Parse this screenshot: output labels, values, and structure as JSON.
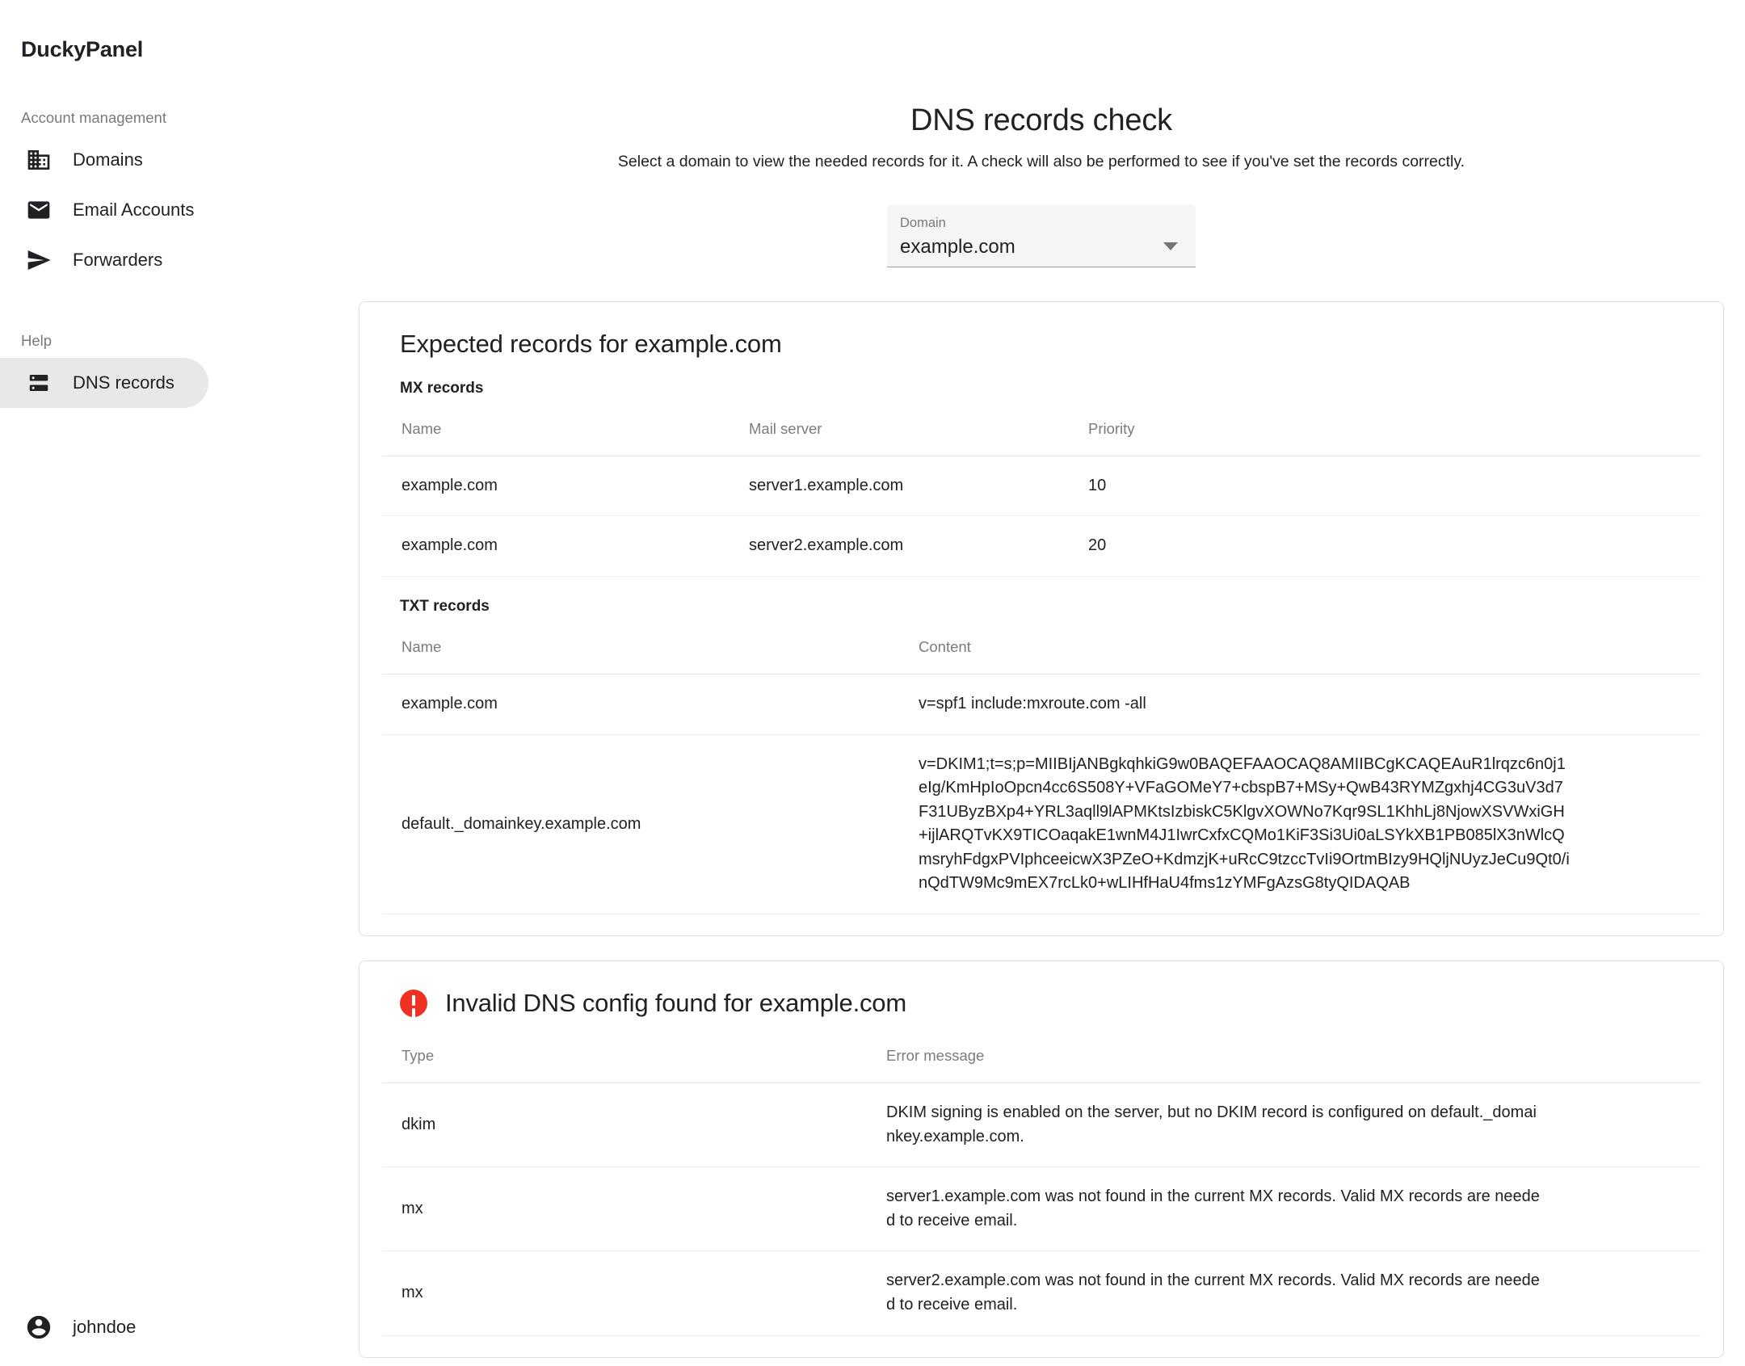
{
  "brand": "DuckyPanel",
  "sidebar": {
    "sections": [
      {
        "label": "Account management"
      },
      {
        "label": "Help"
      }
    ],
    "items": [
      {
        "label": "Domains",
        "icon": "domain-icon",
        "active": false
      },
      {
        "label": "Email Accounts",
        "icon": "email-icon",
        "active": false
      },
      {
        "label": "Forwarders",
        "icon": "send-icon",
        "active": false
      },
      {
        "label": "DNS records",
        "icon": "dns-icon",
        "active": true
      }
    ],
    "user": {
      "name": "johndoe",
      "icon": "account-circle-icon"
    }
  },
  "page": {
    "title": "DNS records check",
    "subtitle": "Select a domain to view the needed records for it. A check will also be performed to see if you've set the records correctly."
  },
  "domain_select": {
    "label": "Domain",
    "value": "example.com",
    "icon": "chevron-down-icon"
  },
  "expected_card": {
    "title": "Expected records for example.com",
    "mx": {
      "section_label": "MX records",
      "headers": [
        "Name",
        "Mail server",
        "Priority"
      ],
      "rows": [
        {
          "name": "example.com",
          "server": "server1.example.com",
          "priority": "10"
        },
        {
          "name": "example.com",
          "server": "server2.example.com",
          "priority": "20"
        }
      ]
    },
    "txt": {
      "section_label": "TXT records",
      "headers": [
        "Name",
        "Content"
      ],
      "rows": [
        {
          "name": "example.com",
          "content": "v=spf1 include:mxroute.com -all"
        },
        {
          "name": "default._domainkey.example.com",
          "content": "v=DKIM1;t=s;p=MIIBIjANBgkqhkiG9w0BAQEFAAOCAQ8AMIIBCgKCAQEAuR1lrqzc6n0j1eIg/KmHpIoOpcn4cc6S508Y+VFaGOMeY7+cbspB7+MSy+QwB43RYMZgxhj4CG3uV3d7F31UByzBXp4+YRL3aqll9lAPMKtsIzbiskC5KlgvXOWNo7Kqr9SL1KhhLj8NjowXSVWxiGH+ijlARQTvKX9TICOaqakE1wnM4J1IwrCxfxCQMo1KiF3Si3Ui0aLSYkXB1PB085lX3nWlcQmsryhFdgxPVIphceeicwX3PZeO+KdmzjK+uRcC9tzccTvIi9OrtmBIzy9HQljNUyzJeCu9Qt0/inQdTW9Mc9mEX7rcLk0+wLIHfHaU4fms1zYMFgAzsG8tyQIDAQAB"
        }
      ]
    }
  },
  "errors_card": {
    "title": "Invalid DNS config found for example.com",
    "icon": "error-icon",
    "headers": [
      "Type",
      "Error message"
    ],
    "rows": [
      {
        "type": "dkim",
        "message": "DKIM signing is enabled on the server, but no DKIM record is configured on default._domainkey.example.com."
      },
      {
        "type": "mx",
        "message": "server1.example.com was not found in the current MX records. Valid MX records are needed to receive email."
      },
      {
        "type": "mx",
        "message": "server2.example.com was not found in the current MX records. Valid MX records are needed to receive email."
      }
    ]
  },
  "colors": {
    "error": "#ef3124",
    "active_nav_bg": "#e8e8e8",
    "text": "#202124",
    "muted": "#7b7b7b"
  }
}
